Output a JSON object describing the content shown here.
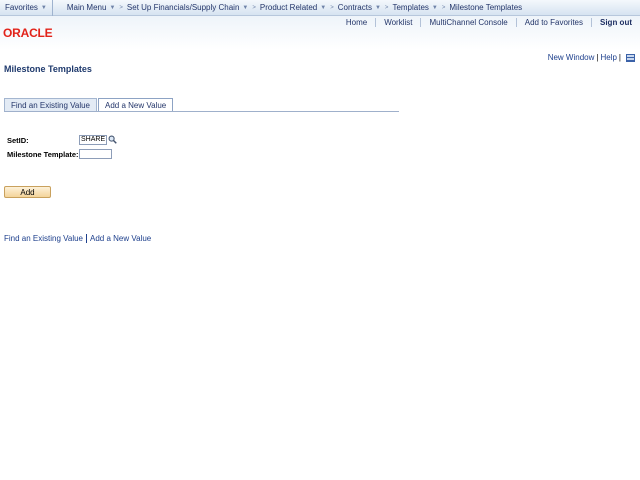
{
  "topnav": {
    "favorites": "Favorites",
    "breadcrumbs": [
      "Main Menu",
      "Set Up Financials/Supply Chain",
      "Product Related",
      "Contracts",
      "Templates",
      "Milestone Templates"
    ]
  },
  "header": {
    "logo": "ORACLE",
    "links": [
      "Home",
      "Worklist",
      "MultiChannel Console",
      "Add to Favorites"
    ],
    "signout": "Sign out"
  },
  "utils": {
    "new_window": "New Window",
    "help": "Help",
    "sep": "|"
  },
  "page": {
    "title": "Milestone Templates"
  },
  "tabs": [
    {
      "label": "Find an Existing Value",
      "active": false
    },
    {
      "label": "Add a New Value",
      "active": true
    }
  ],
  "form": {
    "setid_label": "SetID:",
    "setid_value": "SHARE",
    "template_label": "Milestone Template:",
    "template_value": "",
    "add_button": "Add"
  },
  "bottom_links": {
    "find": "Find an Existing Value",
    "add": "Add a New Value"
  },
  "colors": {
    "accent": "#24366a",
    "logo": "#e2231a",
    "button": "#f4d49a"
  },
  "icons": [
    "chevron-down-icon",
    "breadcrumb-arrow-icon",
    "magnifier-icon",
    "grid-icon"
  ]
}
